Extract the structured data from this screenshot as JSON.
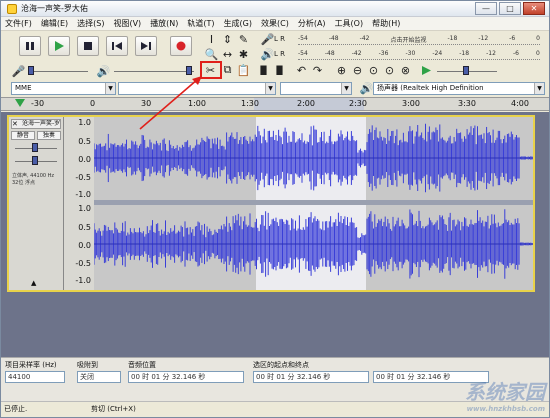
{
  "window": {
    "title": "沧海一声笑-罗大佑",
    "buttons": {
      "min": "—",
      "max": "□",
      "close": "✕"
    }
  },
  "menu": [
    "文件(F)",
    "编辑(E)",
    "选择(S)",
    "视图(V)",
    "播放(N)",
    "轨道(T)",
    "生成(G)",
    "效果(C)",
    "分析(A)",
    "工具(O)",
    "帮助(H)"
  ],
  "meters": {
    "record_scale": [
      "-54",
      "-48",
      "-42",
      "点击开始监视",
      "-18",
      "-12",
      "-6",
      "0"
    ],
    "play_scale": [
      "-54",
      "-48",
      "-42",
      "-36",
      "-30",
      "-24",
      "-18",
      "-12",
      "-6",
      "0"
    ]
  },
  "device": {
    "host": "MME",
    "output": "扬声器 (Realtek High Definition"
  },
  "ruler": {
    "labels": [
      "-30",
      "0",
      "30",
      "1:00",
      "1:30",
      "2:00",
      "2:30",
      "3:00",
      "3:30",
      "4:00"
    ]
  },
  "track": {
    "name": "沧海一声笑-罗",
    "mute": "静音",
    "solo": "独奏",
    "info": "立体声, 44100 Hz\n32位 浮点",
    "scale": [
      "1.0",
      "0.5",
      "0.0",
      "-0.5",
      "-1.0"
    ]
  },
  "selection_toolbar": {
    "rate_label": "项目采样率 (Hz)",
    "rate_value": "44100",
    "snap_label": "吸附到",
    "snap_value": "关闭",
    "pos_label": "音频位置",
    "pos_value": "00 时 01 分 32.146 秒",
    "range_label": "选区的起点和终点",
    "start_value": "00 时 01 分 32.146 秒",
    "end_value": "00 时 01 分 32.146 秒"
  },
  "status": {
    "left": "已停止.",
    "right": "剪切 (Ctrl+X)"
  },
  "watermark": {
    "main": "系统家园",
    "sub": "www.hnzkhbsb.com"
  },
  "colors": {
    "wave": "#3a3fd8",
    "highlight": "#e0201b"
  }
}
